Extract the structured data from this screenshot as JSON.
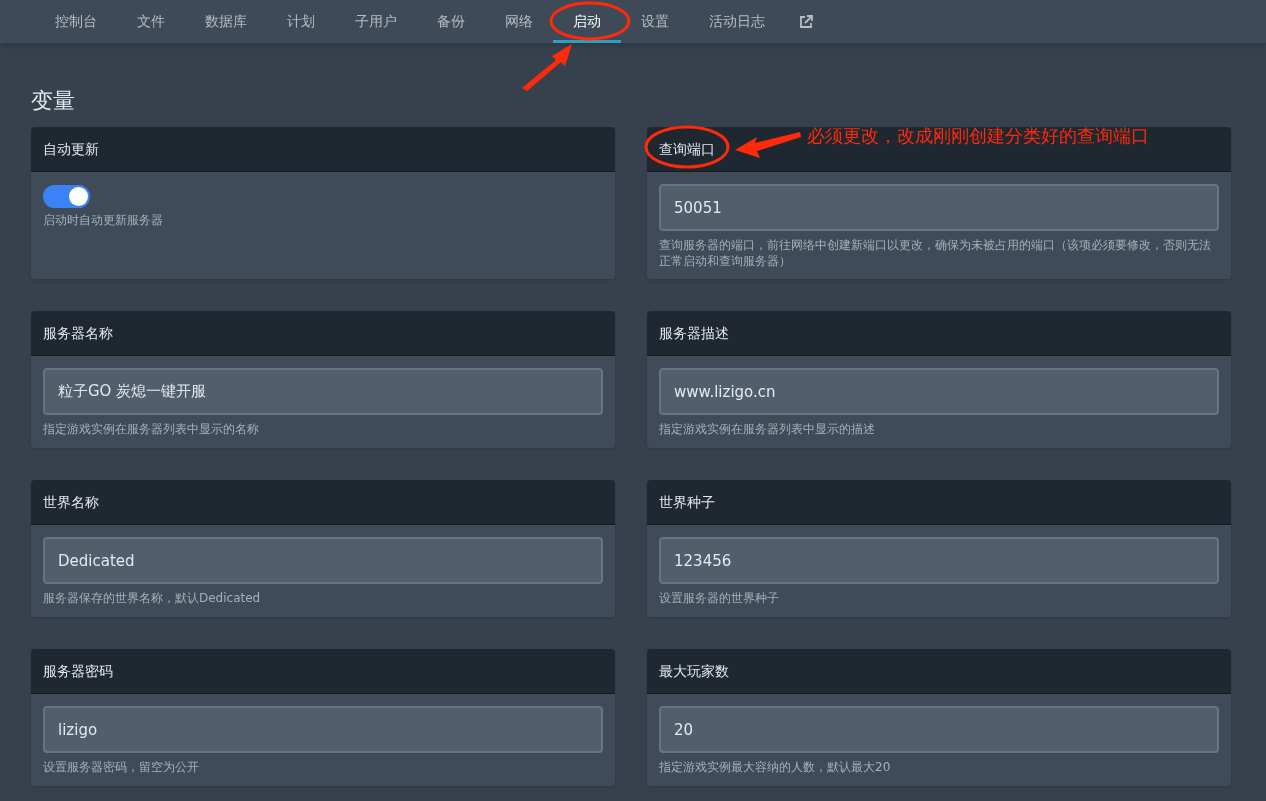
{
  "tabs": [
    {
      "label": "控制台",
      "selected": false
    },
    {
      "label": "文件",
      "selected": false
    },
    {
      "label": "数据库",
      "selected": false
    },
    {
      "label": "计划",
      "selected": false
    },
    {
      "label": "子用户",
      "selected": false
    },
    {
      "label": "备份",
      "selected": false
    },
    {
      "label": "网络",
      "selected": false
    },
    {
      "label": "启动",
      "selected": true
    },
    {
      "label": "设置",
      "selected": false
    },
    {
      "label": "活动日志",
      "selected": false
    }
  ],
  "heading": "变量",
  "variables": [
    {
      "kind": "toggle",
      "title": "自动更新",
      "on": true,
      "description": "启动时自动更新服务器"
    },
    {
      "kind": "text",
      "title": "查询端口",
      "value": "50051",
      "description": "查询服务器的端口，前往网络中创建新端口以更改，确保为未被占用的端口（该项必须要修改，否则无法正常启动和查询服务器）"
    },
    {
      "kind": "text",
      "title": "服务器名称",
      "value": "粒子GO 炭熄一键开服",
      "description": "指定游戏实例在服务器列表中显示的名称"
    },
    {
      "kind": "text",
      "title": "服务器描述",
      "value": "www.lizigo.cn",
      "description": "指定游戏实例在服务器列表中显示的描述"
    },
    {
      "kind": "text",
      "title": "世界名称",
      "value": "Dedicated",
      "description": "服务器保存的世界名称，默认Dedicated"
    },
    {
      "kind": "text",
      "title": "世界种子",
      "value": "123456",
      "description": "设置服务器的世界种子"
    },
    {
      "kind": "text",
      "title": "服务器密码",
      "value": "lizigo",
      "description": "设置服务器密码，留空为公开"
    },
    {
      "kind": "text",
      "title": "最大玩家数",
      "value": "20",
      "description": "指定游戏实例最大容纳的人数，默认最大20"
    }
  ],
  "annotation": {
    "text": "必须更改，改成刚刚创建分类好的查询端口"
  }
}
